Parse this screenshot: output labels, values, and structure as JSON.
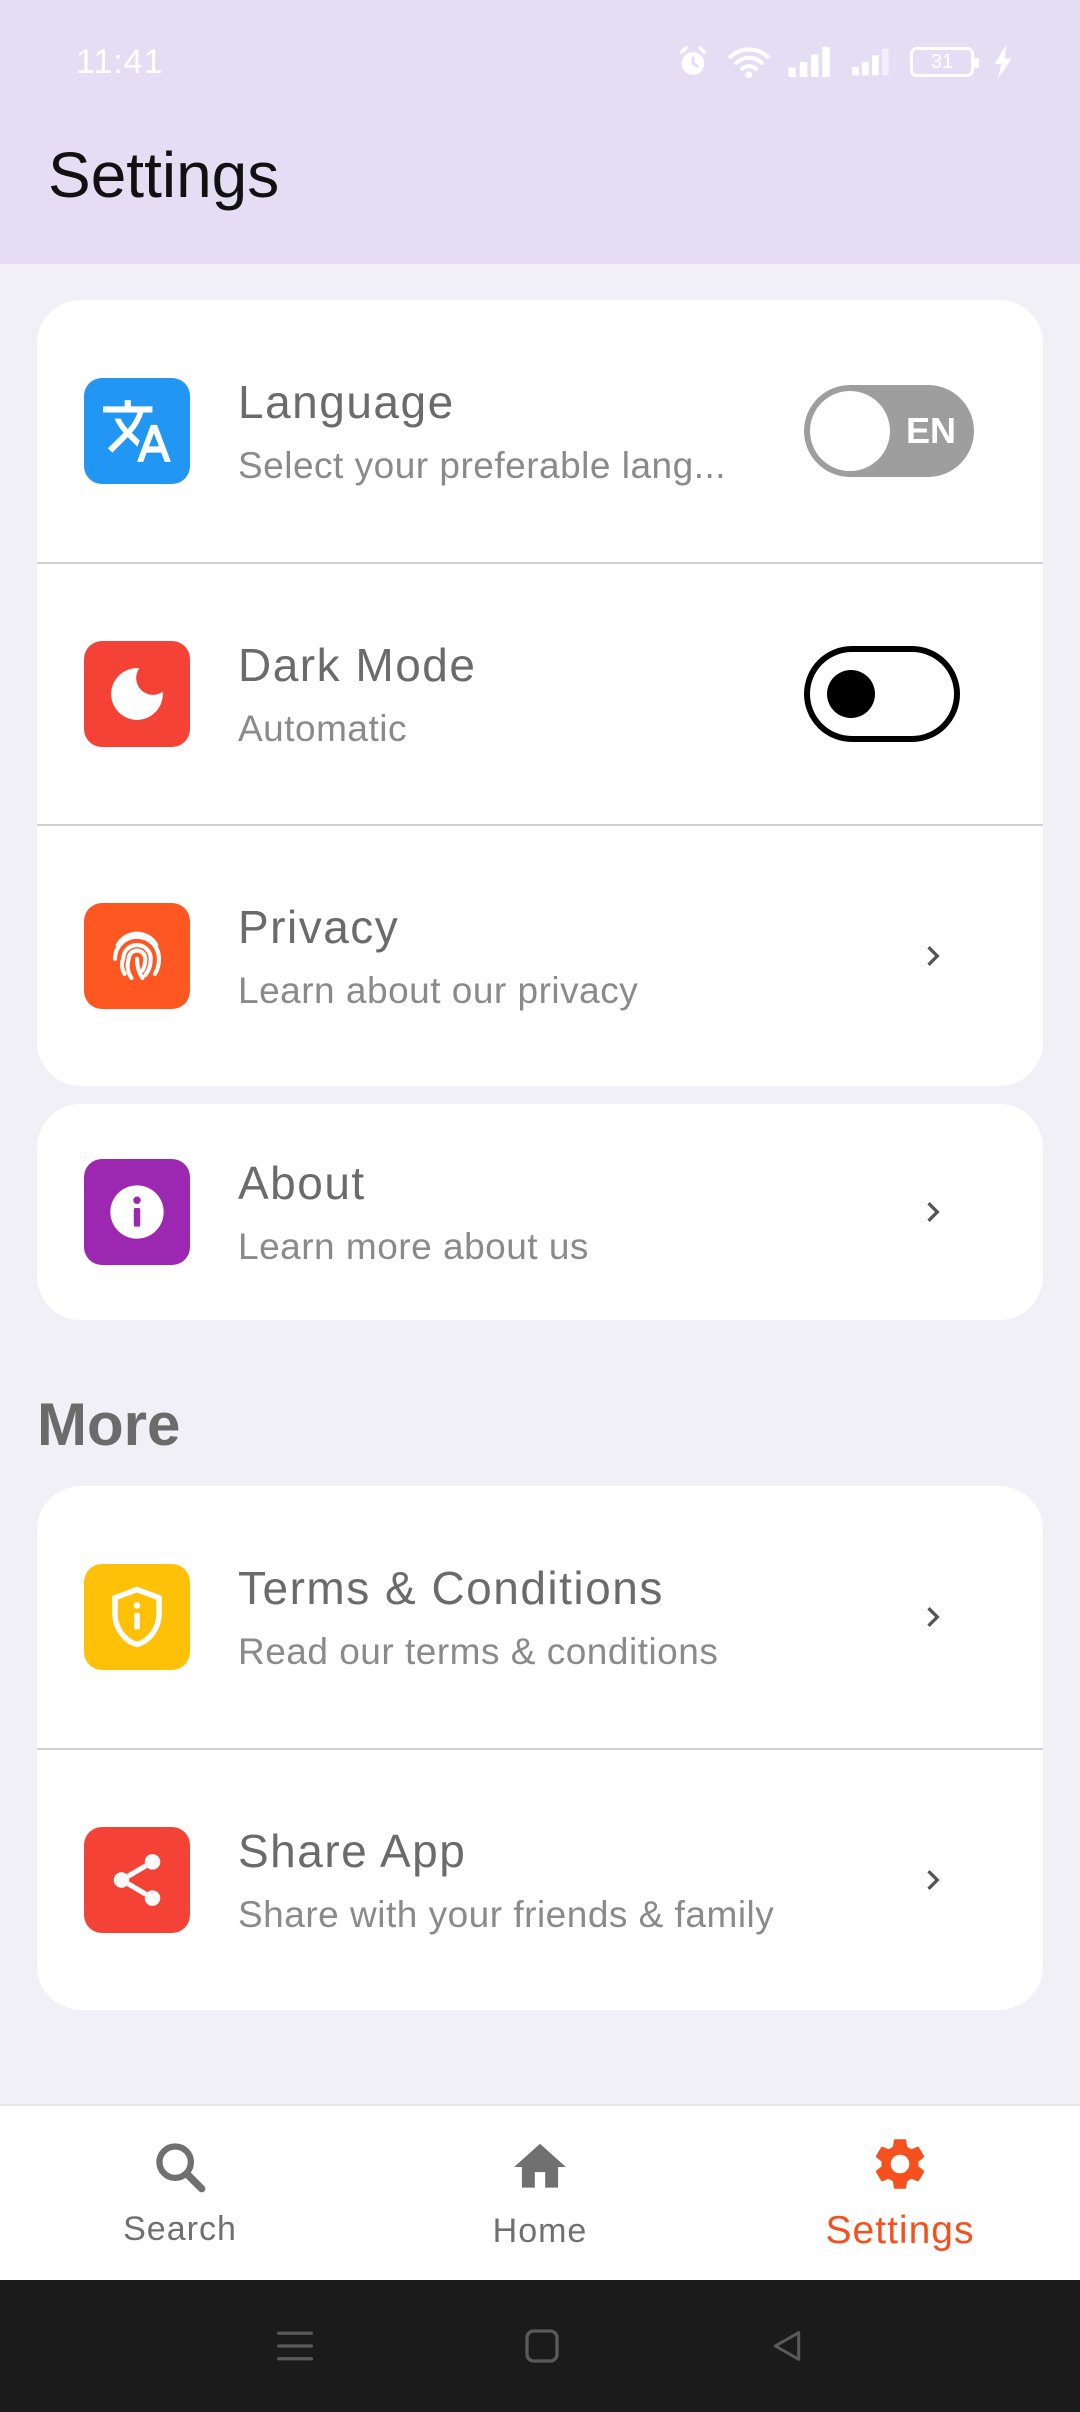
{
  "status_bar": {
    "time": "11:41",
    "battery_level": "31",
    "icons": [
      "alarm-icon",
      "wifi-icon",
      "signal-icon",
      "signal-icon",
      "battery-icon",
      "charging-icon"
    ]
  },
  "header": {
    "title": "Settings"
  },
  "settings": {
    "items": [
      {
        "title": "Language",
        "subtitle": "Select your preferable lang...",
        "icon": "translate-icon",
        "icon_color": "#2196f3",
        "control": "switch",
        "value": "EN",
        "on": false
      },
      {
        "title": "Dark Mode",
        "subtitle": "Automatic",
        "icon": "moon-icon",
        "icon_color": "#f44336",
        "control": "switch",
        "on": false
      },
      {
        "title": "Privacy",
        "subtitle": "Learn about our privacy",
        "icon": "fingerprint-icon",
        "icon_color": "#ff5722",
        "control": "chevron"
      }
    ]
  },
  "about": {
    "items": [
      {
        "title": "About",
        "subtitle": "Learn more about us",
        "icon": "info-icon",
        "icon_color": "#9c27b0",
        "control": "chevron"
      }
    ]
  },
  "more": {
    "heading": "More",
    "items": [
      {
        "title": "Terms & Conditions",
        "subtitle": "Read our terms & conditions",
        "icon": "shield-icon",
        "icon_color": "#ffc107",
        "control": "chevron"
      },
      {
        "title": "Share App",
        "subtitle": "Share with your friends & family",
        "icon": "share-icon",
        "icon_color": "#f44336",
        "control": "chevron"
      }
    ]
  },
  "bottom_nav": {
    "active_color": "#f4511e",
    "items": [
      {
        "label": "Search",
        "icon": "search-icon",
        "active": false
      },
      {
        "label": "Home",
        "icon": "home-icon",
        "active": false
      },
      {
        "label": "Settings",
        "icon": "gear-icon",
        "active": true
      }
    ]
  },
  "system_nav": {
    "icons": [
      "menu-icon",
      "home-square-icon",
      "back-triangle-icon"
    ]
  }
}
